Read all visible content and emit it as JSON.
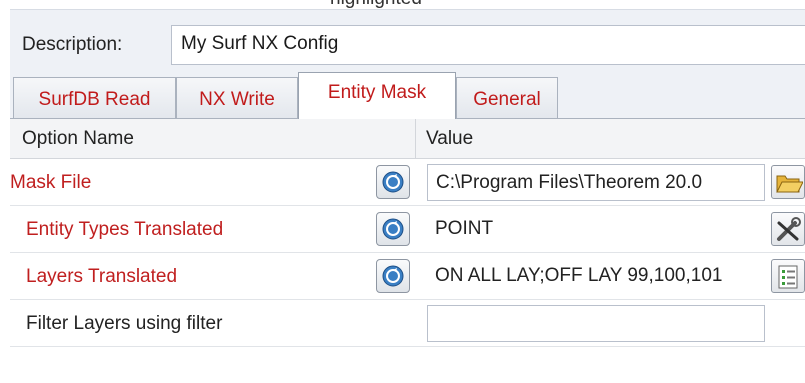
{
  "description": {
    "label": "Description:",
    "value": "My Surf NX Config"
  },
  "tabs": [
    {
      "label": "SurfDB Read",
      "active": false
    },
    {
      "label": "NX Write",
      "active": false
    },
    {
      "label": "Entity Mask",
      "active": true
    },
    {
      "label": "General",
      "active": false
    }
  ],
  "grid": {
    "columns": {
      "option_name": "Option Name",
      "value": "Value"
    },
    "rows": [
      {
        "label": "Mask File",
        "value": "C:\\Program Files\\Theorem 20.0",
        "action_icon": "folder-open-icon"
      },
      {
        "label": "Entity Types Translated",
        "value": "POINT",
        "action_icon": "tools-icon"
      },
      {
        "label": "Layers Translated",
        "value": "ON ALL LAY;OFF LAY 99,100,101",
        "action_icon": "list-editor-icon"
      },
      {
        "label": "Filter Layers using filter",
        "value": ""
      }
    ]
  },
  "colors": {
    "accent_red": "#c01f1f",
    "panel_bg": "#eef1f6",
    "reset_icon_blue": "#3a7fc4"
  }
}
